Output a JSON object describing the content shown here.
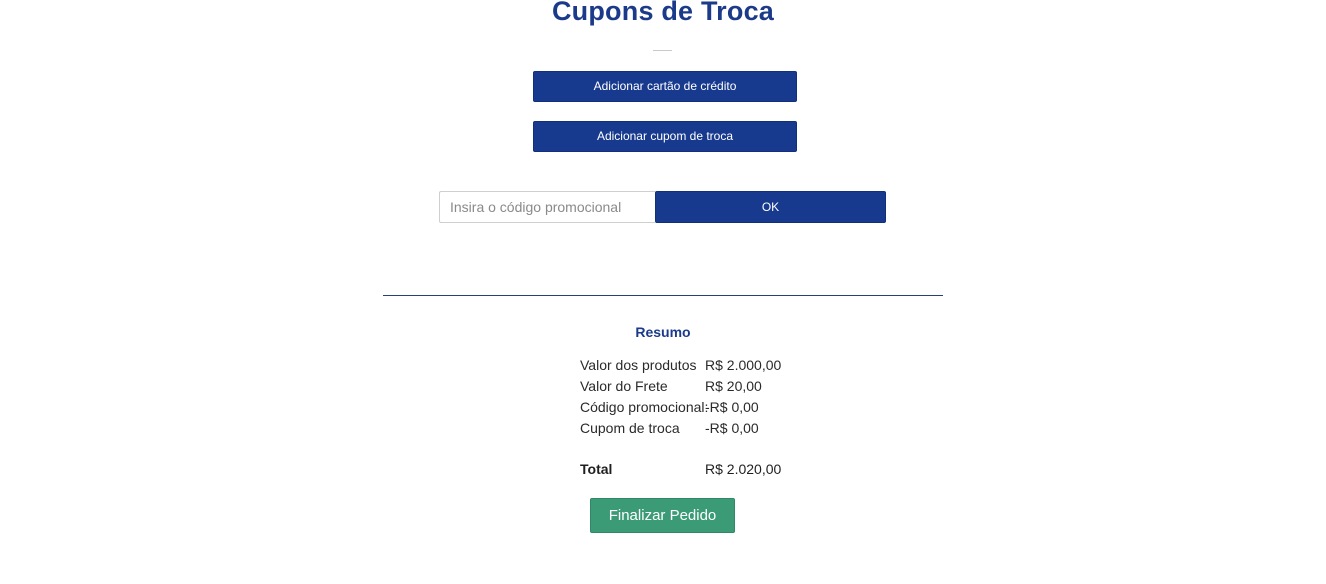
{
  "page": {
    "title": "Cupons de Troca"
  },
  "actions": {
    "add_credit_card": "Adicionar cartão de crédito",
    "add_exchange_coupon": "Adicionar cupom de troca"
  },
  "promo": {
    "placeholder": "Insira o código promocional",
    "value": "",
    "ok_label": "OK"
  },
  "summary": {
    "heading": "Resumo",
    "rows": [
      {
        "label": "Valor dos produtos",
        "value": "R$ 2.000,00"
      },
      {
        "label": "Valor do Frete",
        "value": "R$ 20,00"
      },
      {
        "label": "Código promocional:",
        "value": "-R$ 0,00"
      },
      {
        "label": "Cupom de troca",
        "value": "-R$ 0,00"
      }
    ],
    "total_label": "Total",
    "total_value": "R$ 2.020,00"
  },
  "checkout": {
    "finish_label": "Finalizar Pedido"
  },
  "colors": {
    "primary": "#183a8e",
    "title": "#1b3a8a",
    "success": "#3a9b76",
    "divider": "#2a3f78"
  }
}
